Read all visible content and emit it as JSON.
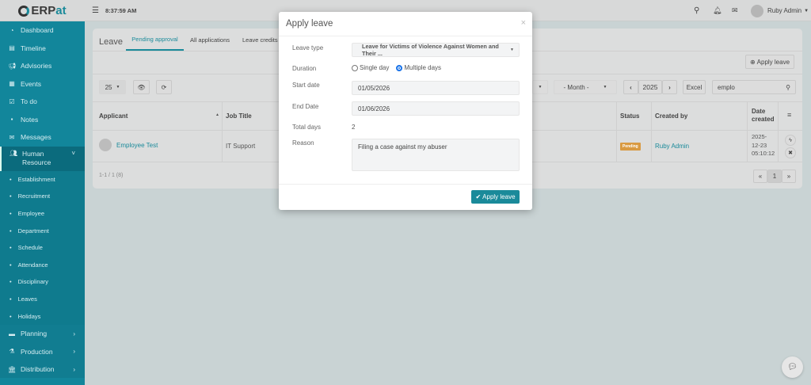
{
  "header": {
    "logo": "ERPat",
    "logo_prefix": "ERP",
    "logo_suffix": "at",
    "time": "8:37:59 AM",
    "user": "Ruby Admin"
  },
  "sidebar": {
    "items": [
      {
        "label": "Dashboard"
      },
      {
        "label": "Timeline"
      },
      {
        "label": "Advisories"
      },
      {
        "label": "Events"
      },
      {
        "label": "To do"
      },
      {
        "label": "Notes"
      },
      {
        "label": "Messages"
      }
    ],
    "human_resource": "Human Resource",
    "hr_sub": [
      "Establishment",
      "Recruitment",
      "Employee",
      "Department",
      "Schedule",
      "Attendance",
      "Disciplinary",
      "Leaves",
      "Holidays"
    ],
    "lower": [
      {
        "label": "Planning"
      },
      {
        "label": "Production"
      },
      {
        "label": "Distribution"
      }
    ]
  },
  "page": {
    "title": "Leave",
    "tabs": [
      "Pending approval",
      "All applications",
      "Leave credits"
    ],
    "apply_button": "Apply leave",
    "page_size": "25",
    "month": "- Month -",
    "year": "2025",
    "excel": "Excel",
    "search_value": "emplo",
    "columns": [
      "Applicant",
      "Job Title",
      "Status",
      "Created by",
      "Date created"
    ],
    "rows": [
      {
        "applicant": "Employee Test",
        "job_title": "IT Support",
        "status": "Pending",
        "created_by": "Ruby Admin",
        "date_created": "2025-12-23 05:10:12"
      }
    ],
    "summary": "1-1 / 1 (8)",
    "pagination": {
      "prev": "«",
      "current": "1",
      "next": "»"
    }
  },
  "modal": {
    "title": "Apply leave",
    "close": "×",
    "labels": {
      "leave_type": "Leave type",
      "duration": "Duration",
      "start_date": "Start date",
      "end_date": "End Date",
      "total_days": "Total days",
      "reason": "Reason"
    },
    "leave_type": "Leave for Victims of Violence Against Women and Their ...",
    "duration_options": [
      "Single day",
      "Multiple days"
    ],
    "duration_selected": "Multiple days",
    "start_date": "01/05/2026",
    "end_date": "01/06/2026",
    "total_days": "2",
    "reason": "Filing a case against my abuser",
    "submit": "Apply leave"
  },
  "colors": {
    "accent": "#1a8a9a",
    "pending": "#e09a3a"
  }
}
